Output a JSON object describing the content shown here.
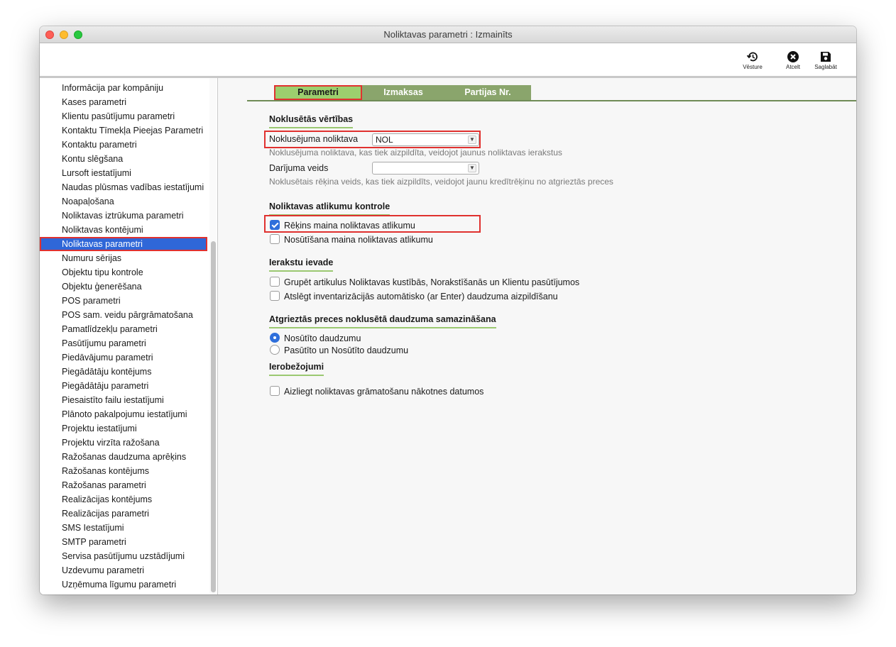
{
  "window": {
    "title": "Noliktavas parametri : Izmainīts"
  },
  "toolbar": {
    "history_label": "Vēsture",
    "cancel_label": "Atcelt",
    "save_label": "Saglabāt"
  },
  "sidebar": {
    "selected_index": 11,
    "items": [
      "Informācija par kompāniju",
      "Kases parametri",
      "Klientu pasūtījumu parametri",
      "Kontaktu Tīmekļa Pieejas Parametri",
      "Kontaktu parametri",
      "Kontu slēgšana",
      "Lursoft iestatījumi",
      "Naudas plūsmas vadības iestatījumi",
      "Noapaļošana",
      "Noliktavas iztrūkuma parametri",
      "Noliktavas kontējumi",
      "Noliktavas parametri",
      "Numuru sērijas",
      "Objektu tipu kontrole",
      "Objektu ģenerēšana",
      "POS parametri",
      "POS sam. veidu pārgrāmatošana",
      "Pamatlīdzekļu parametri",
      "Pasūtījumu parametri",
      "Piedāvājumu parametri",
      "Piegādātāju kontējums",
      "Piegādātāju parametri",
      "Piesaistīto failu iestatījumi",
      "Plānoto pakalpojumu iestatījumi",
      "Projektu iestatījumi",
      "Projektu virzīta ražošana",
      "Ražošanas daudzuma aprēķins",
      "Ražošanas kontējums",
      "Ražošanas parametri",
      "Realizācijas kontējums",
      "Realizācijas parametri",
      "SMS Iestatījumi",
      "SMTP parametri",
      "Servisa pasūtījumu uzstādījumi",
      "Uzdevumu parametri",
      "Uzņēmuma līgumu parametri"
    ]
  },
  "tabs": [
    {
      "label": "Parametri",
      "active": true
    },
    {
      "label": "Izmaksas",
      "active": false
    },
    {
      "label": "Partijas Nr.",
      "active": false
    }
  ],
  "sections": {
    "defaults": {
      "title": "Noklusētās vērtības",
      "warehouse_label": "Noklusējuma noliktava",
      "warehouse_value": "NOL",
      "warehouse_hint": "Noklusējuma noliktava, kas tiek aizpildīta, veidojot jaunus noliktavas ierakstus",
      "transaction_label": "Darījuma veids",
      "transaction_value": "",
      "transaction_hint": "Noklusētais rēķina veids, kas tiek aizpildīts, veidojot jaunu kredītrēķinu no atgrieztās preces"
    },
    "stock_control": {
      "title": "Noliktavas atlikumu kontrole",
      "invoice_changes_label": "Rēķins maina noliktavas atlikumu",
      "invoice_changes_checked": true,
      "shipment_changes_label": "Nosūtīšana maina noliktavas atlikumu",
      "shipment_changes_checked": false
    },
    "entry": {
      "title": "Ierakstu ievade",
      "group_items_label": "Grupēt artikulus Noliktavas kustībās, Norakstīšanās un Klientu pasūtījumos",
      "group_items_checked": false,
      "disable_autofill_label": "Atslēgt inventarizācijās automātisko (ar Enter) daudzuma aizpildīšanu",
      "disable_autofill_checked": false
    },
    "returns": {
      "title": "Atgrieztās preces noklusētā daudzuma samazināšana",
      "option_shipped_label": "Nosūtīto daudzumu",
      "option_ordered_shipped_label": "Pasūtīto un Nosūtīto daudzumu",
      "selected": "shipped"
    },
    "restrictions": {
      "title": "Ierobežojumi",
      "forbid_future_label": "Aizliegt noliktavas grāmatošanu nākotnes datumos",
      "forbid_future_checked": false
    }
  },
  "colors": {
    "accent_green": "#8aa56c",
    "active_tab_green": "#9ccf6e",
    "selection_blue": "#2f67d8",
    "highlight_red": "#e0312f"
  }
}
